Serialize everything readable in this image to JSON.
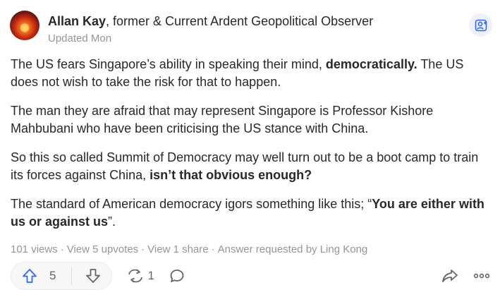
{
  "author": {
    "name": "Allan Kay",
    "credential": ", former & Current Ardent Geopolitical Observer",
    "updated": "Updated Mon"
  },
  "answer": {
    "p1_text": "The US fears Singapore’s ability in speaking their mind, ",
    "p1_bold": "democratically.",
    "p1_tail": " The US does not wish to take the risk for that to happen.",
    "p2": "The man they are afraid that may represent Singapore is Professor Kishore Mahbubani who have been criticising the US stance with China.",
    "p3_text": "So this so called Summit of Democracy may well turn out to be a boot camp to train its forces against China, ",
    "p3_bold": "isn’t that obvious enough?",
    "p4_text": "The standard of American democracy igors something like this; “",
    "p4_bold": "You are either with us or against us",
    "p4_tail": "”."
  },
  "stats": {
    "views": "101 views",
    "upvotes": "View 5 upvotes",
    "shares": "View 1 share",
    "requested": "Answer requested by Ling Kong",
    "separator": "·"
  },
  "actions": {
    "upvote_count": "5",
    "share_count": "1"
  },
  "colors": {
    "accent_blue": "#2e69ff",
    "text": "#282829",
    "muted": "#939598"
  },
  "icons": {
    "follow": "person-add-icon",
    "upvote": "arrow-up-icon",
    "downvote": "arrow-down-icon",
    "share": "reshare-icon",
    "comment": "comment-bubble-icon",
    "forward": "share-forward-icon",
    "more": "more-dots-icon"
  }
}
